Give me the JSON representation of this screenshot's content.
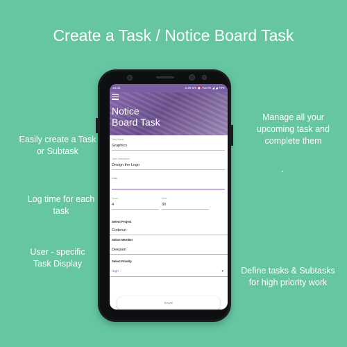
{
  "headline": "Create a Task / Notice Board Task",
  "features": {
    "easy_create": [
      "Easily create a Task",
      "or Subtask"
    ],
    "log_time": [
      "Log time for each",
      "task"
    ],
    "user_specific": [
      "User - specific",
      "Task Display"
    ],
    "manage": [
      "Manage all your",
      "upcoming task and",
      "complete them"
    ],
    "define": [
      "Define tasks & Subtasks",
      "for high priority work"
    ]
  },
  "app": {
    "status": {
      "time": "10:32",
      "right": "0.28 K/s ⏰ VoLTE ◢ ◢ 79%"
    },
    "title": [
      "Notice",
      "Board Task"
    ],
    "form": {
      "task_name": {
        "label": "Task Name",
        "value": "Graphics"
      },
      "task_description": {
        "label": "Task Description",
        "value": "Design the Logo"
      },
      "links": {
        "label": "Links",
        "value": ""
      },
      "hours": {
        "label": "Hours",
        "value": "4"
      },
      "mins": {
        "label": "Mins",
        "value": "30"
      },
      "select_project": {
        "label": "Select Project",
        "value": "Coderun"
      },
      "select_member": {
        "label": "Select Member",
        "value": "Deepam"
      },
      "select_priority": {
        "label": "Select Priority",
        "value": "High"
      },
      "save_label": "SAVE"
    }
  }
}
